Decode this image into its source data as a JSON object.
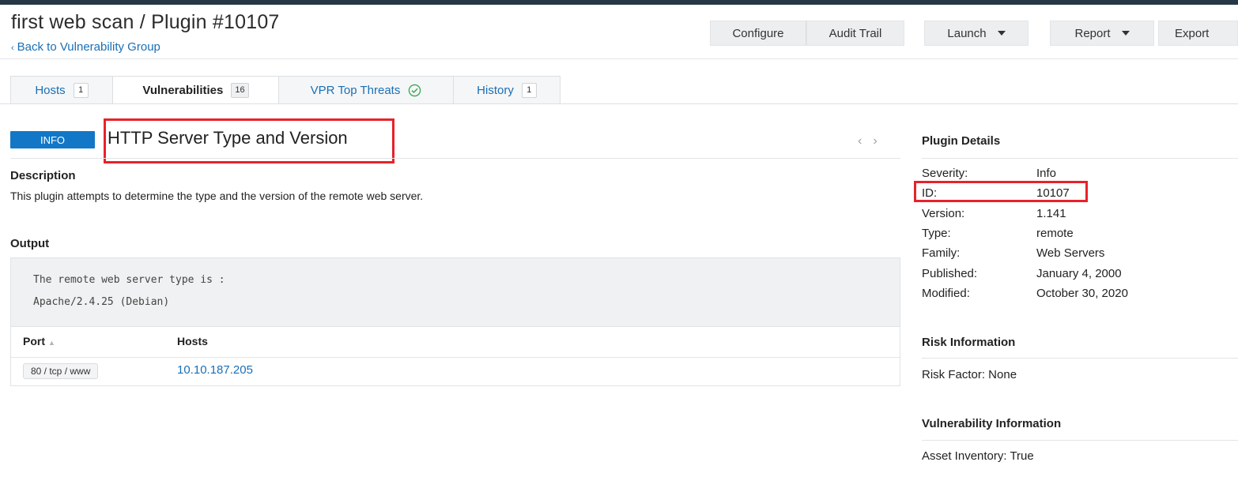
{
  "header": {
    "title": "first web scan / Plugin #10107",
    "back_link": "Back to Vulnerability Group",
    "back_icon": "chevron-left-icon"
  },
  "toolbar": {
    "configure": "Configure",
    "audit_trail": "Audit Trail",
    "launch": "Launch",
    "report": "Report",
    "export": "Export"
  },
  "tabs": [
    {
      "label": "Hosts",
      "count": "1"
    },
    {
      "label": "Vulnerabilities",
      "count": "16",
      "active": true
    },
    {
      "label": "VPR Top Threats",
      "icon": "check-circle-icon"
    },
    {
      "label": "History",
      "count": "1"
    }
  ],
  "vulnerability": {
    "severity": "INFO",
    "title": "HTTP Server Type and Version",
    "prev": "‹",
    "next": "›",
    "description_heading": "Description",
    "description": "This plugin attempts to determine the type and the version of the remote web server.",
    "output_heading": "Output",
    "output_lines": [
      "The remote web server type is :",
      "Apache/2.4.25 (Debian)"
    ]
  },
  "port_table": {
    "columns": [
      "Port",
      "Hosts"
    ],
    "rows": [
      {
        "port": "80 / tcp / www",
        "host": "10.10.187.205"
      }
    ]
  },
  "plugin_details": {
    "heading": "Plugin Details",
    "rows": [
      {
        "label": "Severity:",
        "value": "Info"
      },
      {
        "label": "ID:",
        "value": "10107"
      },
      {
        "label": "Version:",
        "value": "1.141"
      },
      {
        "label": "Type:",
        "value": "remote"
      },
      {
        "label": "Family:",
        "value": "Web Servers"
      },
      {
        "label": "Published:",
        "value": "January 4, 2000"
      },
      {
        "label": "Modified:",
        "value": "October 30, 2020"
      }
    ]
  },
  "risk_information": {
    "heading": "Risk Information",
    "text": "Risk Factor: None"
  },
  "vulnerability_information": {
    "heading": "Vulnerability Information",
    "text": "Asset Inventory: True"
  },
  "colors": {
    "accent": "#1277c7",
    "link": "#1a6fb5",
    "highlight": "#e8222a",
    "topbar": "#263746"
  }
}
